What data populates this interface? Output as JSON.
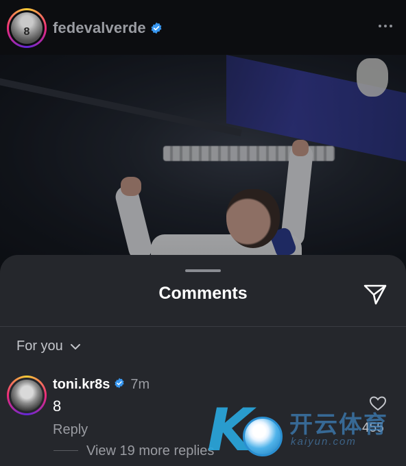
{
  "post": {
    "username": "fedevalverde",
    "avatar_jersey_number": "8",
    "more_icon": "more-horizontal-icon"
  },
  "comments_sheet": {
    "title": "Comments",
    "filter_label": "For you",
    "comment": {
      "username": "toni.kr8s",
      "time": "7m",
      "text": "8",
      "reply_label": "Reply",
      "like_count": "455",
      "view_replies_label": "View 19 more replies"
    }
  },
  "watermark": {
    "chinese_text": "开云体育",
    "url_text": "kaiyun.com"
  },
  "colors": {
    "background": "#0c0d10",
    "sheet": "#25272c",
    "verified": "#3897f0",
    "secondary_text": "#9a9ca2"
  }
}
